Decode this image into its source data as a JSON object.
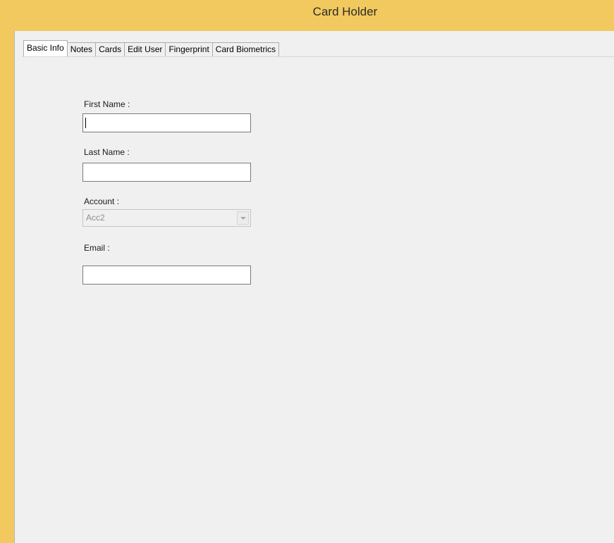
{
  "window": {
    "title": "Card Holder"
  },
  "tabs": [
    {
      "label": "Basic Info",
      "active": true
    },
    {
      "label": "Notes",
      "active": false
    },
    {
      "label": "Cards",
      "active": false
    },
    {
      "label": "Edit User",
      "active": false
    },
    {
      "label": "Fingerprint",
      "active": false
    },
    {
      "label": "Card Biometrics",
      "active": false
    }
  ],
  "form": {
    "first_name": {
      "label": "First Name :",
      "value": ""
    },
    "last_name": {
      "label": "Last Name :",
      "value": ""
    },
    "account": {
      "label": "Account :",
      "value": "Acc2",
      "enabled": false
    },
    "email": {
      "label": "Email :",
      "value": ""
    }
  },
  "colors": {
    "title_bar": "#f2c95e",
    "client_bg": "#f0f0f0",
    "disabled_text": "#8d8d8d"
  }
}
